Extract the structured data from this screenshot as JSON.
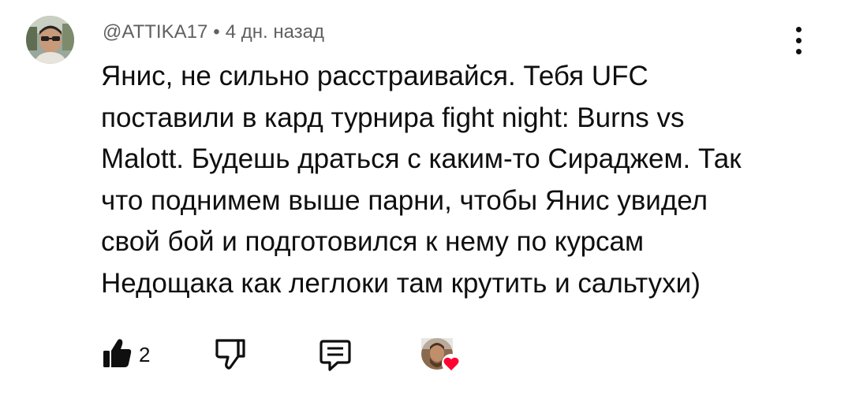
{
  "comment": {
    "author": "@ATTIKA17",
    "separator": "•",
    "time": "4 дн. назад",
    "text": "Янис, не сильно расстраивайся. Тебя UFC\nпоставили в кард турнира fight night: Burns vs\nMalott. Будешь драться с каким-то Сираджем. Так\nчто поднимем выше парни, чтобы Янис увидел\nсвой бой и подготовился к нему по курсам\nНедощака как леглоки там крутить и сальтухи)",
    "likes": "2"
  },
  "icons": {
    "menu": "more-vertical-icon",
    "like": "thumbs-up-filled-icon",
    "dislike": "thumbs-down-icon",
    "reply": "comment-reply-icon",
    "creator_heart": "creator-heart-icon"
  },
  "colors": {
    "text": "#0f0f0f",
    "meta": "#606060",
    "heart": "#ff0033"
  }
}
